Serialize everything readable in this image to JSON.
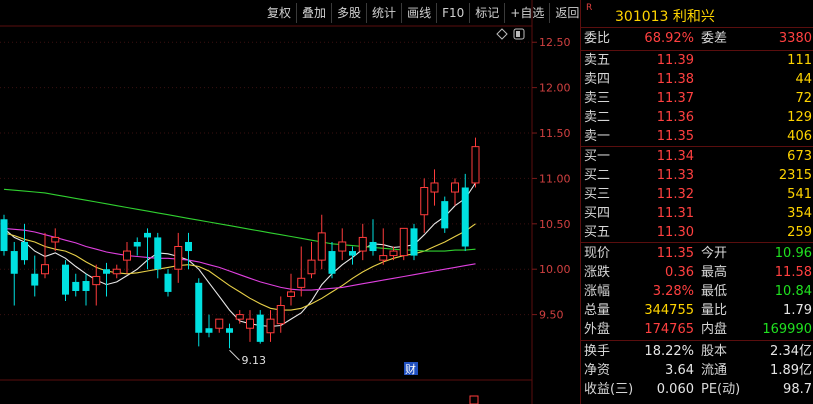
{
  "toolbar": [
    "复权",
    "叠加",
    "多股",
    "统计",
    "画线",
    "F10",
    "标记",
    "+自选",
    "返回"
  ],
  "chart": {
    "y_ticks": [
      "12.50",
      "12.00",
      "11.50",
      "11.00",
      "10.50",
      "10.00",
      "9.50"
    ],
    "low_label": "9.13",
    "badge": "财",
    "colors": {
      "up": "#ff3c3c",
      "down": "#00e0e0",
      "ma1": "#e8e8e8",
      "ma2": "#e8d048",
      "ma3": "#e040e0",
      "ma4": "#30d030"
    }
  },
  "chart_data": {
    "type": "candlestick",
    "y_range": [
      9.0,
      12.8
    ],
    "candles": [
      {
        "o": 10.55,
        "h": 10.6,
        "c": 10.2,
        "l": 10.15
      },
      {
        "o": 10.2,
        "h": 10.3,
        "c": 9.95,
        "l": 9.6
      },
      {
        "o": 10.3,
        "h": 10.5,
        "c": 10.1,
        "l": 10.05
      },
      {
        "o": 9.95,
        "h": 10.15,
        "c": 9.82,
        "l": 9.7
      },
      {
        "o": 9.95,
        "h": 10.4,
        "c": 10.05,
        "l": 9.9
      },
      {
        "o": 10.3,
        "h": 10.45,
        "c": 10.35,
        "l": 10.2
      },
      {
        "o": 10.05,
        "h": 10.1,
        "c": 9.72,
        "l": 9.65
      },
      {
        "o": 9.86,
        "h": 9.95,
        "c": 9.76,
        "l": 9.7
      },
      {
        "o": 9.87,
        "h": 9.95,
        "c": 9.76,
        "l": 9.6
      },
      {
        "o": 9.83,
        "h": 10.05,
        "c": 9.92,
        "l": 9.6
      },
      {
        "o": 10.0,
        "h": 10.07,
        "c": 9.95,
        "l": 9.7
      },
      {
        "o": 9.95,
        "h": 10.05,
        "c": 10.0,
        "l": 9.9
      },
      {
        "o": 10.1,
        "h": 10.3,
        "c": 10.2,
        "l": 9.95
      },
      {
        "o": 10.3,
        "h": 10.35,
        "c": 10.25,
        "l": 10.15
      },
      {
        "o": 10.4,
        "h": 10.45,
        "c": 10.35,
        "l": 10.0
      },
      {
        "o": 10.35,
        "h": 10.4,
        "c": 10.0,
        "l": 9.9
      },
      {
        "o": 9.95,
        "h": 10.0,
        "c": 9.75,
        "l": 9.7
      },
      {
        "o": 10.0,
        "h": 10.4,
        "c": 10.25,
        "l": 9.85
      },
      {
        "o": 10.3,
        "h": 10.4,
        "c": 10.2,
        "l": 10.0
      },
      {
        "o": 9.85,
        "h": 9.9,
        "c": 9.3,
        "l": 9.15
      },
      {
        "o": 9.35,
        "h": 9.5,
        "c": 9.3,
        "l": 9.25
      },
      {
        "o": 9.35,
        "h": 9.45,
        "c": 9.45,
        "l": 9.3
      },
      {
        "o": 9.35,
        "h": 9.4,
        "c": 9.3,
        "l": 9.13
      },
      {
        "o": 9.45,
        "h": 9.55,
        "c": 9.5,
        "l": 9.4
      },
      {
        "o": 9.35,
        "h": 9.55,
        "c": 9.45,
        "l": 9.2
      },
      {
        "o": 9.5,
        "h": 9.55,
        "c": 9.2,
        "l": 9.18
      },
      {
        "o": 9.3,
        "h": 9.55,
        "c": 9.45,
        "l": 9.2
      },
      {
        "o": 9.4,
        "h": 9.7,
        "c": 9.6,
        "l": 9.3
      },
      {
        "o": 9.7,
        "h": 9.95,
        "c": 9.75,
        "l": 9.6
      },
      {
        "o": 9.8,
        "h": 10.25,
        "c": 9.9,
        "l": 9.7
      },
      {
        "o": 9.95,
        "h": 10.3,
        "c": 10.1,
        "l": 9.9
      },
      {
        "o": 10.1,
        "h": 10.6,
        "c": 10.4,
        "l": 10.0
      },
      {
        "o": 10.2,
        "h": 10.3,
        "c": 9.95,
        "l": 9.9
      },
      {
        "o": 10.2,
        "h": 10.45,
        "c": 10.3,
        "l": 10.1
      },
      {
        "o": 10.2,
        "h": 10.25,
        "c": 10.15,
        "l": 10.05
      },
      {
        "o": 10.2,
        "h": 10.5,
        "c": 10.35,
        "l": 10.1
      },
      {
        "o": 10.3,
        "h": 10.55,
        "c": 10.2,
        "l": 10.15
      },
      {
        "o": 10.1,
        "h": 10.45,
        "c": 10.15,
        "l": 10.05
      },
      {
        "o": 10.15,
        "h": 10.25,
        "c": 10.2,
        "l": 10.1
      },
      {
        "o": 10.15,
        "h": 10.45,
        "c": 10.45,
        "l": 10.1
      },
      {
        "o": 10.45,
        "h": 10.5,
        "c": 10.15,
        "l": 10.1
      },
      {
        "o": 10.6,
        "h": 11.0,
        "c": 10.9,
        "l": 10.4
      },
      {
        "o": 10.85,
        "h": 11.1,
        "c": 10.95,
        "l": 10.7
      },
      {
        "o": 10.75,
        "h": 10.8,
        "c": 10.45,
        "l": 10.4
      },
      {
        "o": 10.85,
        "h": 11.0,
        "c": 10.95,
        "l": 10.7
      },
      {
        "o": 10.9,
        "h": 11.05,
        "c": 10.25,
        "l": 10.2
      },
      {
        "o": 10.95,
        "h": 11.45,
        "c": 11.35,
        "l": 10.9
      }
    ],
    "ma": [
      {
        "name": "MA5",
        "values": [
          10.45,
          10.35,
          10.3,
          10.2,
          10.14,
          10.18,
          10.12,
          10.03,
          9.95,
          9.88,
          9.83,
          9.86,
          9.93,
          10.0,
          10.1,
          10.18,
          10.17,
          10.14,
          10.1,
          10.0,
          9.85,
          9.7,
          9.55,
          9.43,
          9.4,
          9.38,
          9.37,
          9.38,
          9.45,
          9.52,
          9.65,
          9.83,
          9.95,
          10.05,
          10.13,
          10.22,
          10.28,
          10.27,
          10.24,
          10.25,
          10.27,
          10.38,
          10.5,
          10.58,
          10.7,
          10.78,
          10.95
        ]
      },
      {
        "name": "MA10",
        "values": [
          10.4,
          10.37,
          10.33,
          10.3,
          10.25,
          10.22,
          10.2,
          10.15,
          10.08,
          10.02,
          9.98,
          9.96,
          9.95,
          9.96,
          9.98,
          10.0,
          10.02,
          10.04,
          10.05,
          10.03,
          9.98,
          9.9,
          9.82,
          9.75,
          9.68,
          9.62,
          9.57,
          9.55,
          9.55,
          9.57,
          9.62,
          9.68,
          9.75,
          9.82,
          9.9,
          9.97,
          10.03,
          10.08,
          10.12,
          10.15,
          10.17,
          10.2,
          10.25,
          10.3,
          10.36,
          10.42,
          10.5
        ]
      },
      {
        "name": "MA20",
        "values": [
          10.45,
          10.44,
          10.43,
          10.41,
          10.38,
          10.35,
          10.32,
          10.29,
          10.25,
          10.22,
          10.19,
          10.17,
          10.15,
          10.14,
          10.13,
          10.12,
          10.12,
          10.11,
          10.1,
          10.08,
          10.05,
          10.02,
          9.98,
          9.94,
          9.9,
          9.86,
          9.83,
          9.8,
          9.78,
          9.77,
          9.77,
          9.78,
          9.79,
          9.8,
          9.82,
          9.84,
          9.86,
          9.88,
          9.9,
          9.92,
          9.94,
          9.96,
          9.98,
          10.0,
          10.02,
          10.04,
          10.06
        ]
      },
      {
        "name": "MA60",
        "values": [
          10.88,
          10.87,
          10.86,
          10.85,
          10.84,
          10.82,
          10.8,
          10.78,
          10.76,
          10.74,
          10.72,
          10.7,
          10.68,
          10.66,
          10.64,
          10.62,
          10.6,
          10.58,
          10.56,
          10.54,
          10.52,
          10.5,
          10.48,
          10.46,
          10.44,
          10.42,
          10.4,
          10.38,
          10.36,
          10.34,
          10.32,
          10.3,
          10.28,
          10.27,
          10.26,
          10.25,
          10.24,
          10.23,
          10.22,
          10.21,
          10.21,
          10.2,
          10.2,
          10.2,
          10.21,
          10.21,
          10.22
        ]
      }
    ]
  },
  "quote": {
    "code": "301013 利和兴",
    "mark": "R",
    "weibi": {
      "l1": "委比",
      "v1": "68.92%",
      "l2": "委差",
      "v2": "3380"
    },
    "asks": [
      {
        "label": "卖五",
        "price": "11.39",
        "vol": "111"
      },
      {
        "label": "卖四",
        "price": "11.38",
        "vol": "44"
      },
      {
        "label": "卖三",
        "price": "11.37",
        "vol": "72"
      },
      {
        "label": "卖二",
        "price": "11.36",
        "vol": "129"
      },
      {
        "label": "卖一",
        "price": "11.35",
        "vol": "406"
      }
    ],
    "bids": [
      {
        "label": "买一",
        "price": "11.34",
        "vol": "673"
      },
      {
        "label": "买二",
        "price": "11.33",
        "vol": "2315"
      },
      {
        "label": "买三",
        "price": "11.32",
        "vol": "541"
      },
      {
        "label": "买四",
        "price": "11.31",
        "vol": "354"
      },
      {
        "label": "买五",
        "price": "11.30",
        "vol": "259"
      }
    ],
    "stats": [
      {
        "l1": "现价",
        "v1": "11.35",
        "l2": "今开",
        "v2": "10.96"
      },
      {
        "l1": "涨跌",
        "v1": "0.36",
        "l2": "最高",
        "v2": "11.58"
      },
      {
        "l1": "涨幅",
        "v1": "3.28%",
        "l2": "最低",
        "v2": "10.84"
      },
      {
        "l1": "总量",
        "v1": "344755",
        "l2": "量比",
        "v2": "1.79"
      },
      {
        "l1": "外盘",
        "v1": "174765",
        "l2": "内盘",
        "v2": "169990"
      }
    ],
    "fund": [
      {
        "l1": "换手",
        "v1": "18.22%",
        "l2": "股本",
        "v2": "2.34亿"
      },
      {
        "l1": "净资",
        "v1": "3.64",
        "l2": "流通",
        "v2": "1.89亿"
      },
      {
        "l1": "收益(三)",
        "v1": "0.060",
        "l2": "PE(动)",
        "v2": "98.7"
      }
    ]
  }
}
